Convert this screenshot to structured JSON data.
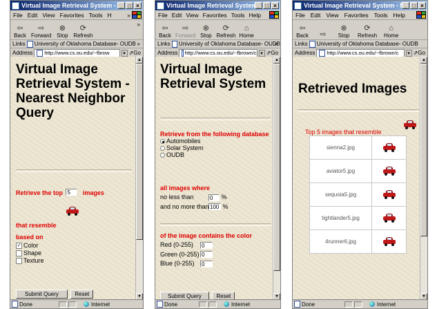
{
  "windows": [
    {
      "title": "Virtual Image Retrieval System - Mic...",
      "menu": [
        "File",
        "Edit",
        "View",
        "Favorites",
        "Tools",
        "H"
      ],
      "menu_overflow": "»",
      "toolbar": [
        {
          "label": "Back",
          "icon": "back-arrow",
          "dropdown": true
        },
        {
          "label": "Forward",
          "icon": "forward-arrow",
          "dropdown": true
        },
        {
          "label": "Stop",
          "icon": "stop"
        },
        {
          "label": "Refresh",
          "icon": "refresh"
        }
      ],
      "links_label": "Links",
      "links_item": "University of Oklahoma Database- OUDB",
      "address_label": "Address",
      "address_value": "http://www.cs.ou.edu/~fbrow",
      "go_label": "Go",
      "status_text": "Done",
      "zone_text": "Internet",
      "page": {
        "heading": "Virtual Image Retrieval System - Nearest Neighbor Query",
        "retrieve_prefix": "Retrieve the top",
        "top_n_value": "5",
        "retrieve_suffix": "images",
        "resemble_label": "that resemble",
        "based_on_label": "based on",
        "options": [
          {
            "label": "Color",
            "checked": true
          },
          {
            "label": "Shape",
            "checked": false
          },
          {
            "label": "Texture",
            "checked": false
          }
        ],
        "submit_label": "Submit Query",
        "reset_label": "Reset"
      }
    },
    {
      "title": "Virtual Image Retrieval System - Micro...",
      "menu": [
        "File",
        "Edit",
        "View",
        "Favorites",
        "Tools",
        "Help"
      ],
      "toolbar": [
        {
          "label": "Back",
          "icon": "back-arrow",
          "dropdown": true
        },
        {
          "label": "Forward",
          "icon": "forward-arrow",
          "dropdown": true,
          "disabled": true
        },
        {
          "label": "Stop",
          "icon": "stop"
        },
        {
          "label": "Refresh",
          "icon": "refresh"
        },
        {
          "label": "Home",
          "icon": "home"
        }
      ],
      "links_label": "Links",
      "links_item": "University of Oklahoma Database- OUDB",
      "address_label": "Address",
      "address_value": "http://www.cs.ou.edu/~fbrown/c",
      "go_label": "Go",
      "status_text": "Done",
      "zone_text": "Internet",
      "page": {
        "heading": "Virtual Image Retrieval System",
        "database_label": "Retrieve from the following database",
        "databases": [
          {
            "label": "Automobiles",
            "selected": true
          },
          {
            "label": "Solar System",
            "selected": false
          },
          {
            "label": "OUDB",
            "selected": false
          }
        ],
        "all_images_label": "all images where",
        "no_less_label": "no less than",
        "no_less_value": "0",
        "no_more_label": "and no more than",
        "no_more_value": "100",
        "percent": "%",
        "color_label": "of the image contains the color",
        "color_fields": [
          {
            "label": "Red (0-255)",
            "value": "0"
          },
          {
            "label": "Green (0-255)",
            "value": "0"
          },
          {
            "label": "Blue (0-255)",
            "value": "0"
          }
        ],
        "submit_label": "Submit Query",
        "reset_label": "Reset"
      }
    },
    {
      "title": "Virtual Image Retrieval System - Micro...",
      "menu": [
        "File",
        "Edit",
        "View",
        "Favorites",
        "Tools",
        "Help"
      ],
      "toolbar": [
        {
          "label": "Back",
          "icon": "back-arrow",
          "dropdown": true
        },
        {
          "label": "",
          "icon": "forward-arrow",
          "dropdown": true,
          "disabled": true
        },
        {
          "label": "Stop",
          "icon": "stop"
        },
        {
          "label": "Refresh",
          "icon": "refresh"
        },
        {
          "label": "Home",
          "icon": "home"
        }
      ],
      "links_label": "Links",
      "links_item": "University of Oklahoma Database- OUDB",
      "address_label": "Address",
      "address_value": "http://www.cs.ou.edu/~fbrown/c",
      "go_label": "Go",
      "status_text": "Done",
      "zone_text": "Internet",
      "page": {
        "heading": "Retrieved Images",
        "top_label": "Top 5 images that resemble",
        "results": [
          "sienna2.jpg",
          "aviator5.jpg",
          "sequoia5.jpg",
          "tightlander5.jpg",
          "4runner6.jpg"
        ]
      }
    }
  ]
}
